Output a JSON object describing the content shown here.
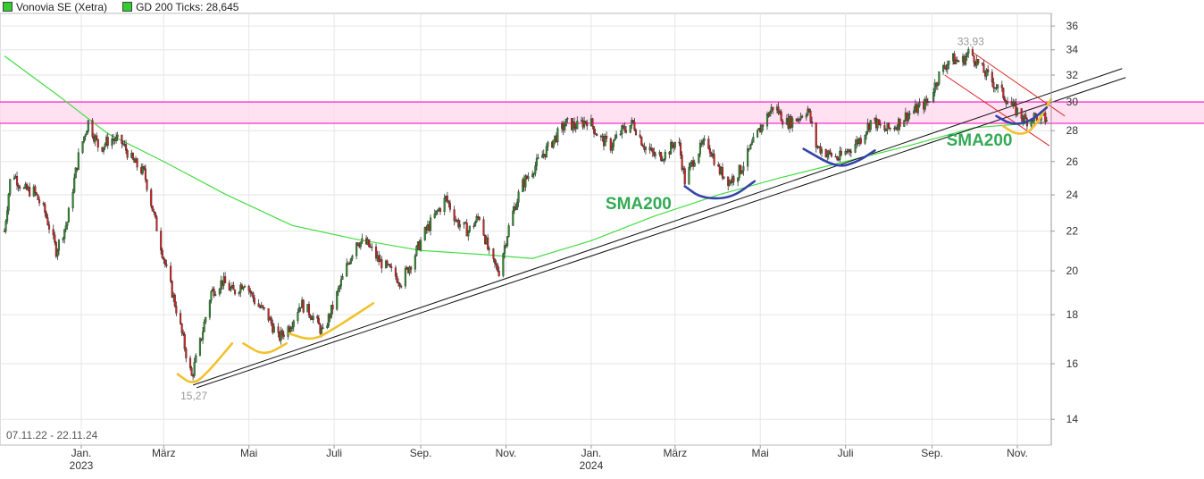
{
  "legend": {
    "stock_label": "Vonovia SE (Xetra)",
    "stock_color": "#33cc33",
    "sma_label": "GD 200 Ticks: 28,645",
    "sma_color": "#33cc33"
  },
  "date_range": "07.11.22 - 22.11.24",
  "chart_data": {
    "type": "candlestick",
    "title": "",
    "xlabel": "",
    "ylabel": "",
    "y_scale": "log",
    "ylim": [
      13,
      36.5
    ],
    "grid": true,
    "x_range": [
      "2022-11-07",
      "2024-11-22"
    ],
    "y_ticks": [
      14,
      16,
      18,
      20,
      22,
      24,
      26,
      28,
      30,
      32,
      34,
      36
    ],
    "x_ticks": [
      {
        "date": "2023-01-01",
        "label": "Jan.",
        "sublabel": "2023"
      },
      {
        "date": "2023-03-01",
        "label": "März",
        "sublabel": ""
      },
      {
        "date": "2023-05-01",
        "label": "Mai",
        "sublabel": ""
      },
      {
        "date": "2023-07-01",
        "label": "Juli",
        "sublabel": ""
      },
      {
        "date": "2023-09-01",
        "label": "Sep.",
        "sublabel": ""
      },
      {
        "date": "2023-11-01",
        "label": "Nov.",
        "sublabel": ""
      },
      {
        "date": "2024-01-01",
        "label": "Jan.",
        "sublabel": "2024"
      },
      {
        "date": "2024-03-01",
        "label": "März",
        "sublabel": ""
      },
      {
        "date": "2024-05-01",
        "label": "Mai",
        "sublabel": ""
      },
      {
        "date": "2024-07-01",
        "label": "Juli",
        "sublabel": ""
      },
      {
        "date": "2024-09-01",
        "label": "Sep.",
        "sublabel": ""
      },
      {
        "date": "2024-11-01",
        "label": "Nov.",
        "sublabel": ""
      }
    ],
    "price_path": [
      [
        "2022-11-07",
        22.0
      ],
      [
        "2022-11-12",
        25.5
      ],
      [
        "2022-11-20",
        24.3
      ],
      [
        "2022-11-28",
        24.2
      ],
      [
        "2022-12-06",
        23.0
      ],
      [
        "2022-12-14",
        21.0
      ],
      [
        "2022-12-22",
        22.5
      ],
      [
        "2022-12-30",
        26.3
      ],
      [
        "2023-01-06",
        28.6
      ],
      [
        "2023-01-14",
        26.8
      ],
      [
        "2023-01-22",
        27.5
      ],
      [
        "2023-01-30",
        27.2
      ],
      [
        "2023-02-07",
        26.0
      ],
      [
        "2023-02-15",
        25.3
      ],
      [
        "2023-02-23",
        22.5
      ],
      [
        "2023-03-03",
        20.0
      ],
      [
        "2023-03-11",
        18.0
      ],
      [
        "2023-03-17",
        16.4
      ],
      [
        "2023-03-21",
        15.5
      ],
      [
        "2023-03-27",
        16.8
      ],
      [
        "2023-04-04",
        19.0
      ],
      [
        "2023-04-12",
        19.5
      ],
      [
        "2023-04-20",
        19.0
      ],
      [
        "2023-04-28",
        19.5
      ],
      [
        "2023-05-06",
        18.5
      ],
      [
        "2023-05-14",
        18.0
      ],
      [
        "2023-05-22",
        17.0
      ],
      [
        "2023-05-30",
        17.5
      ],
      [
        "2023-06-07",
        18.5
      ],
      [
        "2023-06-15",
        18.0
      ],
      [
        "2023-06-23",
        17.2
      ],
      [
        "2023-07-01",
        18.5
      ],
      [
        "2023-07-09",
        20.0
      ],
      [
        "2023-07-17",
        21.5
      ],
      [
        "2023-07-25",
        21.3
      ],
      [
        "2023-08-02",
        20.5
      ],
      [
        "2023-08-10",
        20.0
      ],
      [
        "2023-08-18",
        19.5
      ],
      [
        "2023-08-26",
        20.5
      ],
      [
        "2023-09-03",
        21.8
      ],
      [
        "2023-09-11",
        22.8
      ],
      [
        "2023-09-19",
        23.8
      ],
      [
        "2023-09-27",
        22.5
      ],
      [
        "2023-10-05",
        22.0
      ],
      [
        "2023-10-13",
        22.8
      ],
      [
        "2023-10-21",
        20.5
      ],
      [
        "2023-10-27",
        20.0
      ],
      [
        "2023-11-04",
        22.5
      ],
      [
        "2023-11-12",
        24.5
      ],
      [
        "2023-11-20",
        25.5
      ],
      [
        "2023-11-28",
        26.5
      ],
      [
        "2023-12-06",
        27.5
      ],
      [
        "2023-12-14",
        28.5
      ],
      [
        "2023-12-22",
        28.3
      ],
      [
        "2023-12-30",
        28.8
      ],
      [
        "2024-01-07",
        27.5
      ],
      [
        "2024-01-15",
        27.0
      ],
      [
        "2024-01-23",
        28.0
      ],
      [
        "2024-01-31",
        28.5
      ],
      [
        "2024-02-08",
        27.0
      ],
      [
        "2024-02-16",
        26.3
      ],
      [
        "2024-02-24",
        26.5
      ],
      [
        "2024-03-03",
        27.5
      ],
      [
        "2024-03-08",
        24.8
      ],
      [
        "2024-03-16",
        26.5
      ],
      [
        "2024-03-24",
        27.3
      ],
      [
        "2024-04-01",
        25.5
      ],
      [
        "2024-04-09",
        24.8
      ],
      [
        "2024-04-17",
        25.5
      ],
      [
        "2024-04-25",
        27.0
      ],
      [
        "2024-05-03",
        28.5
      ],
      [
        "2024-05-11",
        29.8
      ],
      [
        "2024-05-19",
        28.5
      ],
      [
        "2024-05-27",
        28.8
      ],
      [
        "2024-06-04",
        29.5
      ],
      [
        "2024-06-10",
        27.0
      ],
      [
        "2024-06-18",
        26.5
      ],
      [
        "2024-06-26",
        26.2
      ],
      [
        "2024-07-04",
        26.8
      ],
      [
        "2024-07-12",
        27.5
      ],
      [
        "2024-07-20",
        28.8
      ],
      [
        "2024-07-28",
        28.0
      ],
      [
        "2024-08-05",
        28.3
      ],
      [
        "2024-08-13",
        29.0
      ],
      [
        "2024-08-21",
        29.5
      ],
      [
        "2024-08-29",
        30.0
      ],
      [
        "2024-09-06",
        32.0
      ],
      [
        "2024-09-14",
        33.3
      ],
      [
        "2024-09-22",
        33.0
      ],
      [
        "2024-09-28",
        33.9
      ],
      [
        "2024-10-06",
        32.5
      ],
      [
        "2024-10-14",
        31.5
      ],
      [
        "2024-10-22",
        30.5
      ],
      [
        "2024-10-30",
        29.5
      ],
      [
        "2024-11-07",
        28.7
      ],
      [
        "2024-11-14",
        29.0
      ],
      [
        "2024-11-22",
        28.8
      ]
    ],
    "sma200_path": [
      [
        "2022-11-07",
        33.5
      ],
      [
        "2022-12-15",
        30.5
      ],
      [
        "2023-01-20",
        27.8
      ],
      [
        "2023-03-01",
        26.0
      ],
      [
        "2023-04-15",
        24.0
      ],
      [
        "2023-06-01",
        22.3
      ],
      [
        "2023-07-15",
        21.6
      ],
      [
        "2023-09-01",
        21.0
      ],
      [
        "2023-10-15",
        20.8
      ],
      [
        "2023-11-20",
        20.6
      ],
      [
        "2024-01-01",
        21.5
      ],
      [
        "2024-02-15",
        22.8
      ],
      [
        "2024-04-01",
        24.0
      ],
      [
        "2024-05-15",
        25.0
      ],
      [
        "2024-07-01",
        26.0
      ],
      [
        "2024-08-15",
        27.0
      ],
      [
        "2024-10-01",
        28.2
      ],
      [
        "2024-11-22",
        28.6
      ]
    ],
    "resistance_band": {
      "low": 28.5,
      "high": 30.0,
      "color": "#ff33cc"
    },
    "support_trendline": {
      "start": [
        "2023-03-22",
        15.2
      ],
      "end": [
        "2025-01-15",
        32.5
      ]
    },
    "descending_channel": {
      "upper": {
        "start": [
          "2024-09-30",
          33.8
        ],
        "end": [
          "2024-12-05",
          29.0
        ]
      },
      "lower": {
        "start": [
          "2024-09-10",
          32.0
        ],
        "end": [
          "2024-11-24",
          27.0
        ]
      }
    },
    "annotations": [
      {
        "type": "price_label",
        "text": "33,93",
        "date": "2024-09-28",
        "value": 33.93
      },
      {
        "type": "price_label",
        "text": "15,27",
        "date": "2023-03-22",
        "value": 15.27
      },
      {
        "type": "text",
        "text": "SMA200",
        "date": "2024-01-01",
        "value": 23.2,
        "color": "#33aa55"
      },
      {
        "type": "text",
        "text": "SMA200",
        "date": "2024-09-01",
        "value": 27.0,
        "color": "#33aa55"
      }
    ],
    "arcs_yellow": [
      [
        [
          "2023-03-11",
          15.6
        ],
        [
          "2023-03-22",
          15.2
        ],
        [
          "2023-04-02",
          15.7
        ],
        [
          "2023-04-19",
          16.8
        ]
      ],
      [
        [
          "2023-04-27",
          16.8
        ],
        [
          "2023-05-12",
          16.3
        ],
        [
          "2023-05-28",
          16.8
        ]
      ],
      [
        [
          "2023-05-30",
          17.2
        ],
        [
          "2023-06-15",
          16.9
        ],
        [
          "2023-07-01",
          17.4
        ],
        [
          "2023-07-29",
          18.5
        ]
      ],
      [
        [
          "2024-10-22",
          28.3
        ],
        [
          "2024-11-01",
          27.7
        ],
        [
          "2024-11-12",
          28.0
        ],
        [
          "2024-11-25",
          30.2
        ]
      ]
    ],
    "arcs_blue": [
      [
        [
          "2024-03-08",
          24.5
        ],
        [
          "2024-03-20",
          23.8
        ],
        [
          "2024-04-10",
          23.8
        ],
        [
          "2024-04-27",
          24.8
        ]
      ],
      [
        [
          "2024-06-01",
          26.8
        ],
        [
          "2024-06-25",
          25.6
        ],
        [
          "2024-07-10",
          26.0
        ],
        [
          "2024-07-22",
          26.7
        ]
      ],
      [
        [
          "2024-10-17",
          29.0
        ],
        [
          "2024-10-28",
          28.4
        ],
        [
          "2024-11-10",
          28.6
        ],
        [
          "2024-11-22",
          29.6
        ]
      ]
    ]
  }
}
